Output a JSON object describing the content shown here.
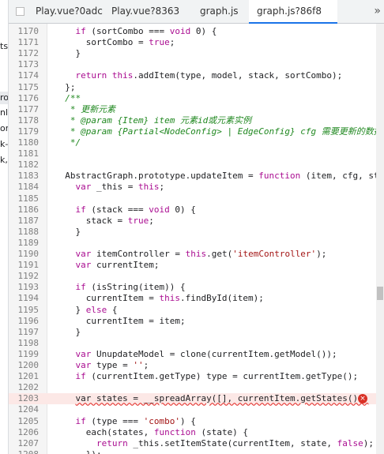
{
  "left_panel": {
    "fragments": [
      "ts",
      "ro",
      "nl",
      "or",
      "k-",
      "k,"
    ]
  },
  "tabs": [
    {
      "label": "Play.vue?0adc"
    },
    {
      "label": "Play.vue?8363"
    },
    {
      "label": "graph.js"
    },
    {
      "label": "graph.js?86f8"
    }
  ],
  "overflow_label": "»",
  "error_icon": "×",
  "colors": {
    "keyword": "#aa0d91",
    "string": "#a31515",
    "comment": "#208820",
    "error_bg": "#fce8e6",
    "tab_active": "#1a73e8"
  },
  "lines": [
    {
      "n": "1170",
      "t": [
        [
          "    ",
          ""
        ],
        [
          "if",
          "kw"
        ],
        [
          " (sortCombo === ",
          ""
        ],
        [
          "void",
          "kw"
        ],
        [
          " 0) {",
          ""
        ]
      ]
    },
    {
      "n": "1171",
      "t": [
        [
          "      sortCombo = ",
          ""
        ],
        [
          "true",
          "kw"
        ],
        [
          ";",
          ""
        ]
      ]
    },
    {
      "n": "1172",
      "t": [
        [
          "    }",
          ""
        ]
      ]
    },
    {
      "n": "1173",
      "t": []
    },
    {
      "n": "1174",
      "t": [
        [
          "    ",
          ""
        ],
        [
          "return",
          "kw"
        ],
        [
          " ",
          ""
        ],
        [
          "this",
          "kw"
        ],
        [
          ".addItem(type, model, stack, sortCombo);",
          ""
        ]
      ]
    },
    {
      "n": "1175",
      "t": [
        [
          "  };",
          ""
        ]
      ]
    },
    {
      "n": "1176",
      "t": [
        [
          "  /**",
          "cm"
        ]
      ]
    },
    {
      "n": "1177",
      "t": [
        [
          "   * 更新元素",
          "cm"
        ]
      ]
    },
    {
      "n": "1178",
      "t": [
        [
          "   * @param {Item} item 元素id或元素实例",
          "cm"
        ]
      ]
    },
    {
      "n": "1179",
      "t": [
        [
          "   * @param {Partial<NodeConfig> | EdgeConfig} cfg 需要更新的数据",
          "cm"
        ]
      ]
    },
    {
      "n": "1180",
      "t": [
        [
          "   */",
          "cm"
        ]
      ]
    },
    {
      "n": "1181",
      "t": []
    },
    {
      "n": "1182",
      "t": []
    },
    {
      "n": "1183",
      "t": [
        [
          "  AbstractGraph.prototype.updateItem = ",
          ""
        ],
        [
          "function",
          "kw"
        ],
        [
          " (item, cfg, stack",
          ""
        ]
      ]
    },
    {
      "n": "1184",
      "t": [
        [
          "    ",
          ""
        ],
        [
          "var",
          "kw"
        ],
        [
          " _this = ",
          ""
        ],
        [
          "this",
          "kw"
        ],
        [
          ";",
          ""
        ]
      ]
    },
    {
      "n": "1185",
      "t": []
    },
    {
      "n": "1186",
      "t": [
        [
          "    ",
          ""
        ],
        [
          "if",
          "kw"
        ],
        [
          " (stack === ",
          ""
        ],
        [
          "void",
          "kw"
        ],
        [
          " 0) {",
          ""
        ]
      ]
    },
    {
      "n": "1187",
      "t": [
        [
          "      stack = ",
          ""
        ],
        [
          "true",
          "kw"
        ],
        [
          ";",
          ""
        ]
      ]
    },
    {
      "n": "1188",
      "t": [
        [
          "    }",
          ""
        ]
      ]
    },
    {
      "n": "1189",
      "t": []
    },
    {
      "n": "1190",
      "t": [
        [
          "    ",
          ""
        ],
        [
          "var",
          "kw"
        ],
        [
          " itemController = ",
          ""
        ],
        [
          "this",
          "kw"
        ],
        [
          ".get(",
          ""
        ],
        [
          "'itemController'",
          "st"
        ],
        [
          ");",
          ""
        ]
      ]
    },
    {
      "n": "1191",
      "t": [
        [
          "    ",
          ""
        ],
        [
          "var",
          "kw"
        ],
        [
          " currentItem;",
          ""
        ]
      ]
    },
    {
      "n": "1192",
      "t": []
    },
    {
      "n": "1193",
      "t": [
        [
          "    ",
          ""
        ],
        [
          "if",
          "kw"
        ],
        [
          " (isString(item)) {",
          ""
        ]
      ]
    },
    {
      "n": "1194",
      "t": [
        [
          "      currentItem = ",
          ""
        ],
        [
          "this",
          "kw"
        ],
        [
          ".findById(item);",
          ""
        ]
      ]
    },
    {
      "n": "1195",
      "t": [
        [
          "    } ",
          ""
        ],
        [
          "else",
          "kw"
        ],
        [
          " {",
          ""
        ]
      ]
    },
    {
      "n": "1196",
      "t": [
        [
          "      currentItem = item;",
          ""
        ]
      ]
    },
    {
      "n": "1197",
      "t": [
        [
          "    }",
          ""
        ]
      ]
    },
    {
      "n": "1198",
      "t": []
    },
    {
      "n": "1199",
      "t": [
        [
          "    ",
          ""
        ],
        [
          "var",
          "kw"
        ],
        [
          " UnupdateModel = clone(currentItem.getModel());",
          ""
        ]
      ]
    },
    {
      "n": "1200",
      "t": [
        [
          "    ",
          ""
        ],
        [
          "var",
          "kw"
        ],
        [
          " type = ",
          ""
        ],
        [
          "''",
          "st"
        ],
        [
          ";",
          ""
        ]
      ]
    },
    {
      "n": "1201",
      "t": [
        [
          "    ",
          ""
        ],
        [
          "if",
          "kw"
        ],
        [
          " (currentItem.getType) type = currentItem.getType();",
          ""
        ]
      ]
    },
    {
      "n": "1202",
      "t": []
    },
    {
      "n": "1203",
      "err": true,
      "t": [
        [
          "    ",
          ""
        ],
        [
          "var states = __spreadArray([], currentItem.getStates());",
          "sq"
        ]
      ]
    },
    {
      "n": "1204",
      "t": []
    },
    {
      "n": "1205",
      "t": [
        [
          "    ",
          ""
        ],
        [
          "if",
          "kw"
        ],
        [
          " (type === ",
          ""
        ],
        [
          "'combo'",
          "st"
        ],
        [
          ") {",
          ""
        ]
      ]
    },
    {
      "n": "1206",
      "t": [
        [
          "      each(states, ",
          ""
        ],
        [
          "function",
          "kw"
        ],
        [
          " (state) {",
          ""
        ]
      ]
    },
    {
      "n": "1207",
      "t": [
        [
          "        ",
          ""
        ],
        [
          "return",
          "kw"
        ],
        [
          " _this.setItemState(currentItem, state, ",
          ""
        ],
        [
          "false",
          "kw"
        ],
        [
          ");",
          ""
        ]
      ]
    },
    {
      "n": "1208",
      "t": [
        [
          "      });",
          ""
        ]
      ]
    }
  ]
}
